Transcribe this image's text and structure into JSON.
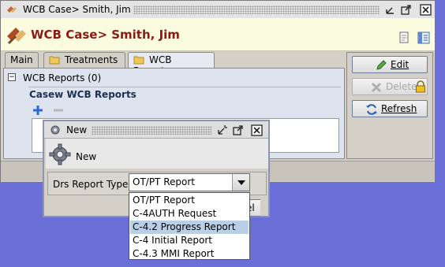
{
  "window": {
    "title": "WCB Case> Smith, Jim"
  },
  "header": {
    "title": "WCB Case> Smith, Jim"
  },
  "tabs": [
    {
      "label": "Main"
    },
    {
      "label": "Treatments"
    },
    {
      "label": "WCB Reports"
    }
  ],
  "tree": {
    "toggle": "−",
    "label": "WCB Reports (0)"
  },
  "group": {
    "title": "Casew WCB Reports"
  },
  "actions": {
    "edit": "Edit",
    "delete": "Delete",
    "refresh": "Refresh"
  },
  "dialog": {
    "title": "New",
    "heading": "New",
    "field_label": "Drs Report Type:",
    "selected_value": "OT/PT Report",
    "partial_button": "el",
    "options": [
      "OT/PT Report",
      "C-4AUTH Request",
      "C-4.2 Progress Report",
      "C-4 Initial Report",
      "C-4.3 MMI Report"
    ],
    "highlighted_option": "C-4.2 Progress Report"
  }
}
